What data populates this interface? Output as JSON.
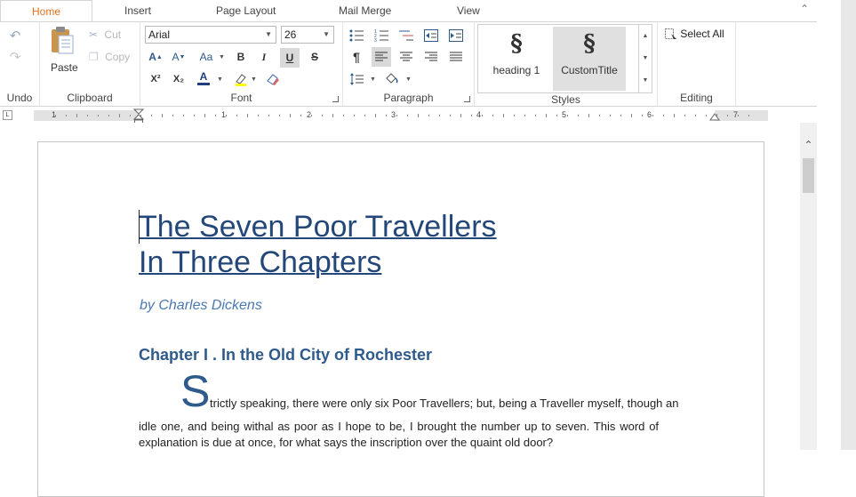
{
  "tabs": [
    {
      "label": "Home",
      "active": true
    },
    {
      "label": "Insert"
    },
    {
      "label": "Page Layout"
    },
    {
      "label": "Mail Merge"
    },
    {
      "label": "View"
    }
  ],
  "collapse_icon": "chevron-up-icon",
  "ribbon": {
    "undo": {
      "label": "Undo",
      "undo_icon": "undo-icon",
      "redo_icon": "redo-icon"
    },
    "clipboard": {
      "label": "Clipboard",
      "paste": "Paste",
      "cut": "Cut",
      "copy": "Copy"
    },
    "font": {
      "label": "Font",
      "family": "Arial",
      "size": "26",
      "grow_glyph": "A",
      "shrink_glyph": "A",
      "case_glyph": "Aa",
      "bold_glyph": "B",
      "italic_glyph": "I",
      "underline_glyph": "U",
      "strike_glyph": "S",
      "superscript_glyph": "X²",
      "subscript_glyph": "X₂",
      "fontcolor_glyph": "A",
      "fontcolor_bar": "#1f3d7a",
      "highlight_bar": "#ffff00"
    },
    "paragraph": {
      "label": "Paragraph",
      "pilcrow": "¶"
    },
    "styles": {
      "label": "Styles",
      "items": [
        {
          "symbol": "§",
          "name": "heading 1"
        },
        {
          "symbol": "§",
          "name": "CustomTitle",
          "selected": true
        }
      ]
    },
    "editing": {
      "label": "Editing",
      "select_all": "Select All"
    }
  },
  "ruler": {
    "corner": "L",
    "numbers": [
      "1",
      "1",
      "2",
      "3",
      "4",
      "5",
      "6",
      "7"
    ]
  },
  "document": {
    "title_line1": "The Seven Poor Travellers",
    "title_line2": "In Three Chapters",
    "author": "by Charles Dickens",
    "chapter_heading": "Chapter I . In the Old City of Rochester",
    "dropcap": "S",
    "para_line1": "trictly speaking, there were only six Poor Travellers; but, being a Traveller myself, though an",
    "para_line2": "idle one, and being withal as poor as I hope to be, I brought the number up to seven. This word of",
    "para_line3": "explanation is due at once, for what says the inscription over the quaint old door?"
  },
  "colors": {
    "accent_tab": "#e8701a",
    "title": "#24477a",
    "heading": "#2e5a8c",
    "author": "#4a78b0"
  }
}
